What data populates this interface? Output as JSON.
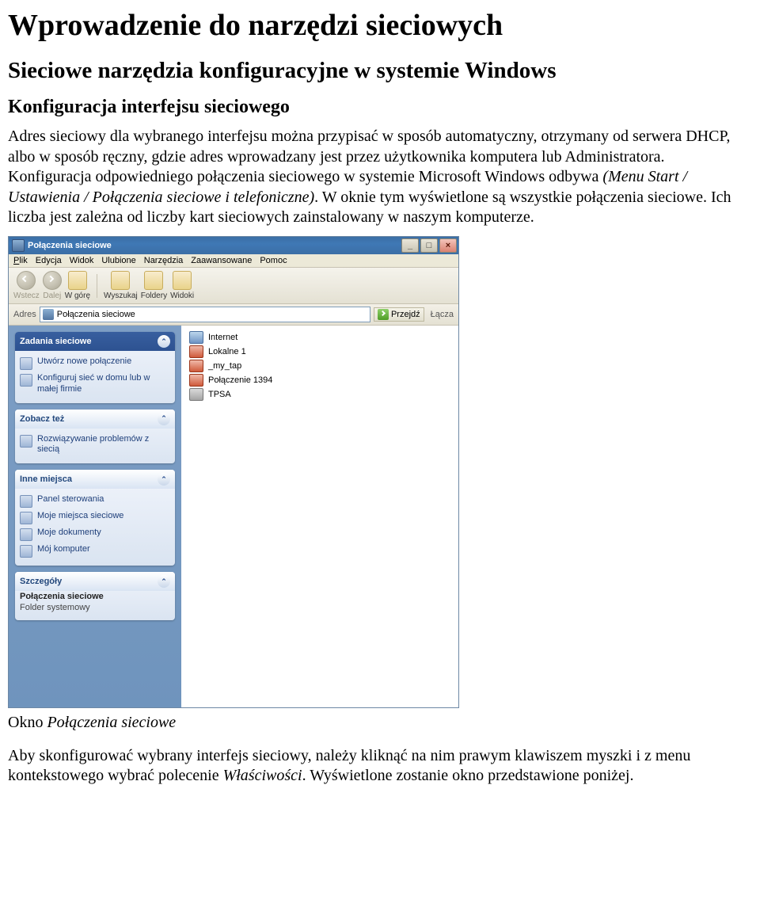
{
  "doc": {
    "h1": "Wprowadzenie do narzędzi sieciowych",
    "h2": "Sieciowe narzędzia konfiguracyjne w systemie Windows",
    "h3": "Konfiguracja interfejsu sieciowego",
    "p1_a": "Adres sieciowy dla wybranego interfejsu można przypisać w sposób automatyczny, otrzymany od serwera DHCP, albo w sposób ręczny, gdzie adres wprowadzany jest przez użytkownika komputera lub Administratora. Konfiguracja odpowiedniego połączenia sieciowego w systemie Microsoft Windows odbywa ",
    "p1_i": "(Menu Start / Ustawienia / Połączenia sieciowe i telefoniczne)",
    "p1_b": ". W oknie tym wyświetlone są wszystkie połączenia sieciowe. Ich liczba jest zależna od liczby kart sieciowych zainstalowany w naszym komputerze.",
    "caption_a": "Okno ",
    "caption_i": "Połączenia sieciowe",
    "p2_a": "Aby skonfigurować wybrany interfejs sieciowy, należy kliknąć na nim prawym klawiszem myszki i z menu kontekstowego wybrać polecenie ",
    "p2_i": "Właściwości",
    "p2_b": ". Wyświetlone zostanie okno przedstawione poniżej."
  },
  "win": {
    "title": "Połączenia sieciowe",
    "menu": {
      "m0": "Plik",
      "m1": "Edycja",
      "m2": "Widok",
      "m3": "Ulubione",
      "m4": "Narzędzia",
      "m5": "Zaawansowane",
      "m6": "Pomoc"
    },
    "tb": {
      "back": "Wstecz",
      "fwd": "Dalej",
      "up": "W górę",
      "search": "Wyszukaj",
      "folders": "Foldery",
      "views": "Widoki"
    },
    "addrlabel": "Adres",
    "addrtext": "Połączenia sieciowe",
    "go": "Przejdź",
    "links": "Łącza",
    "panel1": {
      "title": "Zadania sieciowe",
      "i0": "Utwórz nowe połączenie",
      "i1": "Konfiguruj sieć w domu lub w małej firmie"
    },
    "panel2": {
      "title": "Zobacz też",
      "i0": "Rozwiązywanie problemów z siecią"
    },
    "panel3": {
      "title": "Inne miejsca",
      "i0": "Panel sterowania",
      "i1": "Moje miejsca sieciowe",
      "i2": "Moje dokumenty",
      "i3": "Mój komputer"
    },
    "panel4": {
      "title": "Szczegóły",
      "line1": "Połączenia sieciowe",
      "line2": "Folder systemowy"
    },
    "files": {
      "f0": "Internet",
      "f1": "Lokalne 1",
      "f2": "_my_tap",
      "f3": "Połączenie 1394",
      "f4": "TPSA"
    }
  }
}
